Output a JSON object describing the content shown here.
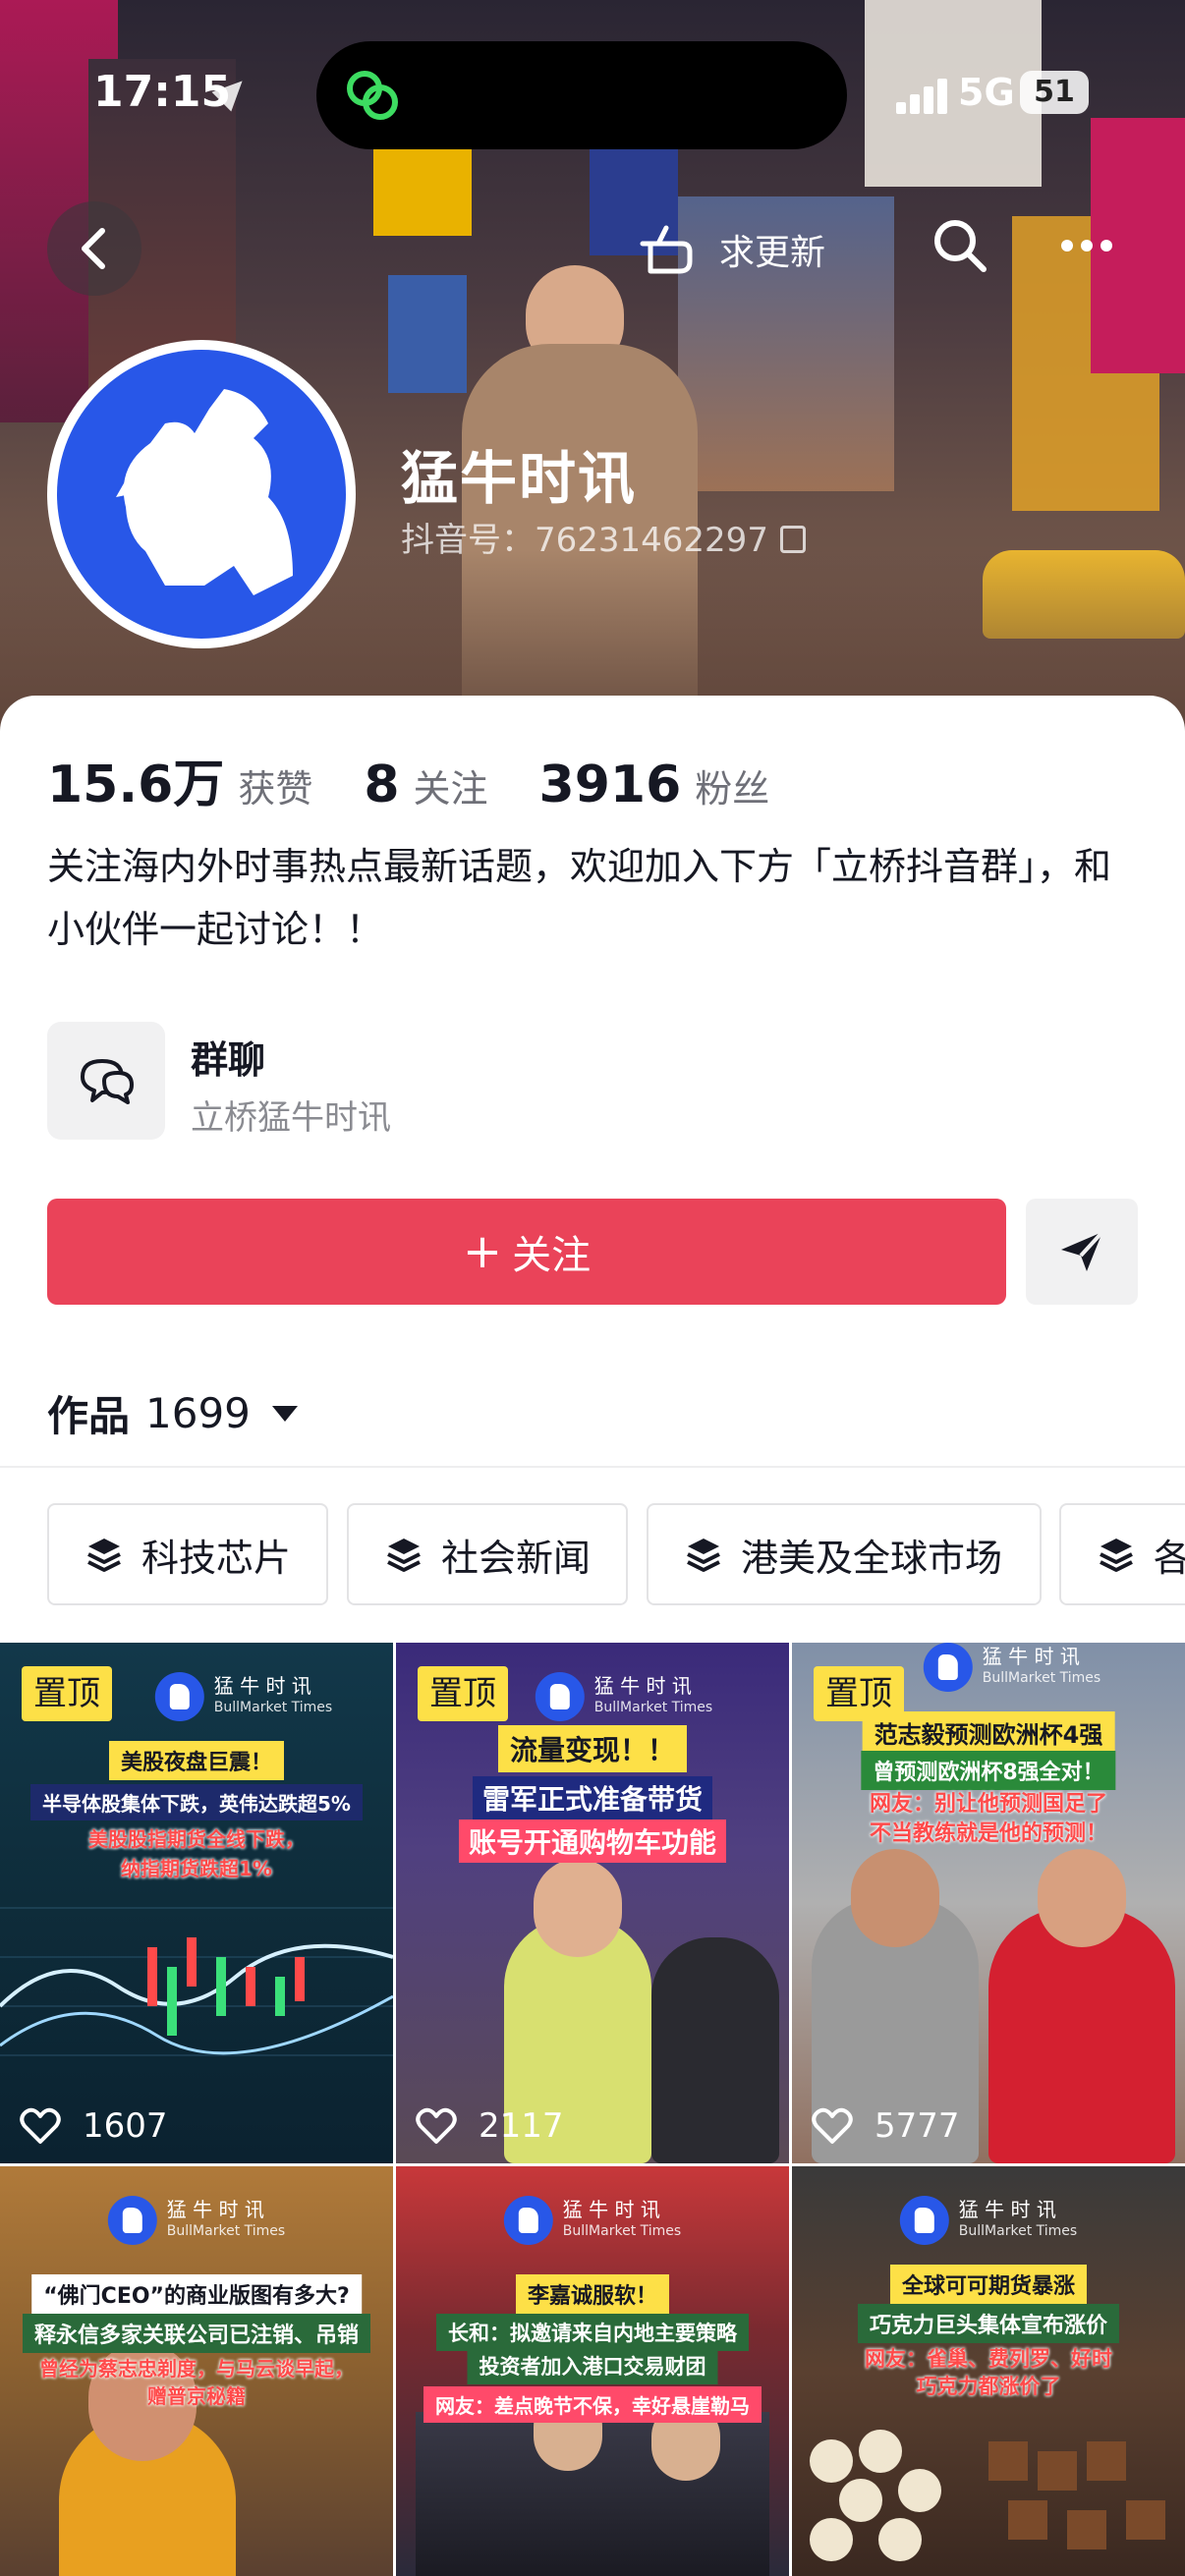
{
  "status_bar": {
    "time": "17:15",
    "network": "5G",
    "battery": "51"
  },
  "nav": {
    "request_update": "求更新"
  },
  "profile": {
    "name": "猛牛时讯",
    "douyin_id": "抖音号：76231462297"
  },
  "stats": [
    {
      "value": "15.6万",
      "label": "获赞"
    },
    {
      "value": "8",
      "label": "关注"
    },
    {
      "value": "3916",
      "label": "粉丝"
    }
  ],
  "bio": "关注海内外时事热点最新话题，欢迎加入下方「立桥抖音群」，和小伙伴一起讨论！！",
  "group_chat": {
    "title": "群聊",
    "subtitle": "立桥猛牛时讯"
  },
  "actions": {
    "follow_plus": "+",
    "follow_label": "关注"
  },
  "works": {
    "label": "作品",
    "count": "1699"
  },
  "collections": [
    "科技芯片",
    "社会新闻",
    "港美及全球市场",
    "各"
  ],
  "brand": {
    "cn": "猛 牛 时 讯",
    "en": "BullMarket Times"
  },
  "pinned_label": "置顶",
  "videos": [
    {
      "pinned": true,
      "likes": "1607",
      "headline1": "美股夜盘巨震！",
      "headline2": "半导体股集体下跌，英伟达跌超5%",
      "headline3": "美股股指期货全线下跌，",
      "headline4": "纳指期货跌超1%"
    },
    {
      "pinned": true,
      "likes": "2117",
      "headline1": "流量变现！！",
      "headline2": "雷军正式准备带货",
      "headline3": "账号开通购物车功能"
    },
    {
      "pinned": true,
      "likes": "5777",
      "headline1": "范志毅预测欧洲杯4强",
      "headline2": "曾预测欧洲杯8强全对！",
      "headline3": "网友：别让他预测国足了",
      "headline4": "不当教练就是他的预测！"
    },
    {
      "pinned": false,
      "likes": "",
      "headline1": "“佛门CEO”的商业版图有多大?",
      "headline2": "释永信多家关联公司已注销、吊销",
      "headline3": "曾经为蔡志忠剃度，与马云谈早起，",
      "headline4": "赠普京秘籍"
    },
    {
      "pinned": false,
      "likes": "",
      "headline1": "李嘉诚服软！",
      "headline2": "长和：拟邀请来自内地主要策略",
      "headline3": "投资者加入港口交易财团",
      "headline4": "网友：差点晚节不保，幸好悬崖勒马"
    },
    {
      "pinned": false,
      "likes": "",
      "headline1": "全球可可期货暴涨",
      "headline2": "巧克力巨头集体宣布涨价",
      "headline3": "网友：雀巢、费列罗、好时",
      "headline4": "巧克力都涨价了"
    }
  ]
}
